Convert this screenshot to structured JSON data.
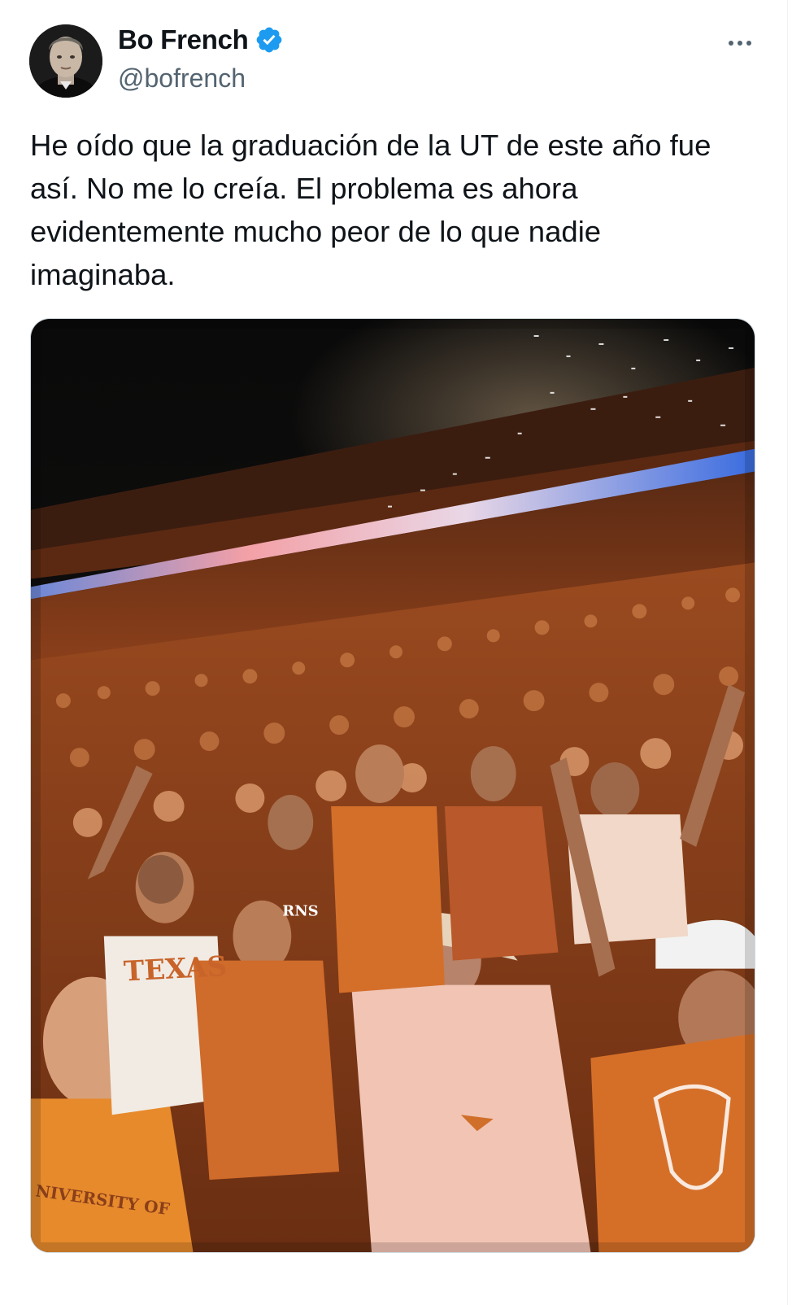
{
  "author": {
    "name": "Bo French",
    "handle": "@bofrench",
    "verified": true,
    "verified_color": "#1d9bf0"
  },
  "tweet": {
    "text": "He oído que la graduación de la UT de este año fue\nasí. No me lo creía. El problema es ahora\nevidentemente mucho peor de lo que nadie\nimaginaba."
  },
  "media": {
    "alt": "Photo of a stadium crowd in burnt orange celebrating with confetti",
    "shirt_texts": [
      "TEXAS",
      "RNS",
      "NIVERSITY OF"
    ]
  },
  "icons": {
    "more": "more-horizontal-icon",
    "verified": "verified-badge-icon"
  },
  "colors": {
    "text_primary": "#0f1419",
    "text_secondary": "#536471",
    "burnt_orange": "#c8642a"
  }
}
